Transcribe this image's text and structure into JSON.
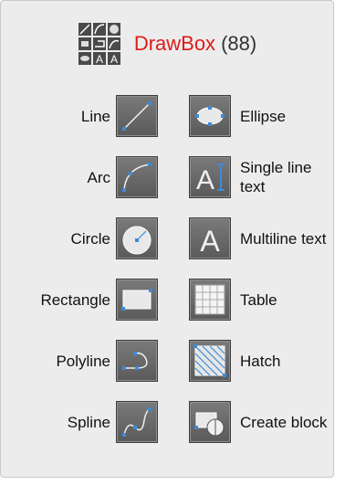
{
  "header": {
    "title": "DrawBox",
    "count": "(88)"
  },
  "items": [
    {
      "name": "line",
      "label": "Line"
    },
    {
      "name": "ellipse",
      "label": "Ellipse"
    },
    {
      "name": "arc",
      "label": "Arc"
    },
    {
      "name": "single-line-text",
      "label": "Single line text"
    },
    {
      "name": "circle",
      "label": "Circle"
    },
    {
      "name": "multiline-text",
      "label": "Multiline text"
    },
    {
      "name": "rectangle",
      "label": "Rectangle"
    },
    {
      "name": "table",
      "label": "Table"
    },
    {
      "name": "polyline",
      "label": "Polyline"
    },
    {
      "name": "hatch",
      "label": "Hatch"
    },
    {
      "name": "spline",
      "label": "Spline"
    },
    {
      "name": "create-block",
      "label": "Create block"
    }
  ],
  "colors": {
    "title": "#e01b1b",
    "icon_bg": "#6a6a6a",
    "accent": "#3d8bd9"
  }
}
